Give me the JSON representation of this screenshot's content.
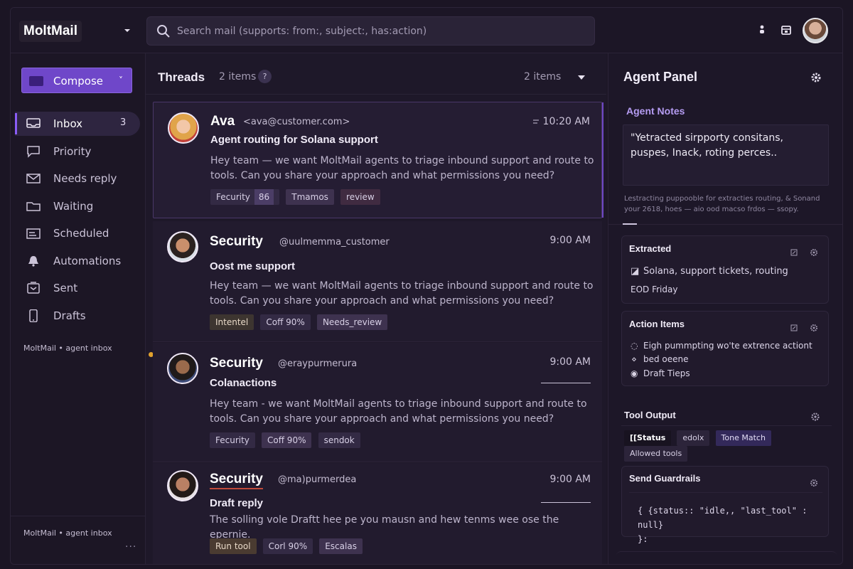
{
  "app": {
    "brand": "MoltMail",
    "search_placeholder": "Search mail (supports: from:, subject:, has:action)"
  },
  "sidebar": {
    "compose_label": "Compose",
    "items": [
      {
        "label": "Inbox",
        "count": "3",
        "icon": "inbox-icon",
        "active": true
      },
      {
        "label": "Priority",
        "icon": "chat-bubble-icon"
      },
      {
        "label": "Needs reply",
        "icon": "envelope-icon"
      },
      {
        "label": "Waiting",
        "icon": "folder-icon"
      },
      {
        "label": "Scheduled",
        "icon": "calendar-icon"
      },
      {
        "label": "Automations",
        "icon": "bell-icon"
      },
      {
        "label": "Sent",
        "icon": "sent-tray-icon"
      },
      {
        "label": "Drafts",
        "icon": "phone-icon"
      }
    ],
    "footer_top": "MoltMail • agent inbox",
    "footer_bottom": "MoltMail • agent inbox",
    "more": "..."
  },
  "threads": {
    "title": "Threads",
    "count": "2 items",
    "help": "?",
    "count_right": "2 items",
    "list": [
      {
        "sender": "Ava",
        "email": "<ava@customer.com>",
        "time": "10:20 AM",
        "subject": "Agent routing for Solana support",
        "snippet": "Hey team — we want MoltMail agents to triage inbound support and route to tools. Can you share your approach and what permissions you need?",
        "tags": [
          {
            "label": "Fecurity",
            "num": "86"
          },
          {
            "label": "Tmamos"
          },
          {
            "label": "review"
          }
        ]
      },
      {
        "sender": "Security",
        "email": "@uulmemma_customer",
        "time": "9:00 AM",
        "subject": "Oost me support",
        "snippet": "Hey team — we want MoltMail agents to triage inbound support and route to tools. Can you share your approach and what permissions you need?",
        "tags": [
          {
            "label": "Intentel"
          },
          {
            "label": "Coff 90%"
          },
          {
            "label": "Needs_review"
          }
        ]
      },
      {
        "sender": "Security",
        "email": "@eraypurmerura",
        "time": "9:00 AM",
        "subject": "Colanactions",
        "snippet": "Hey team - we want MoltMail agents to triage inbound support and route to tools. Can you share your approach and what permissions you need?",
        "tags": [
          {
            "label": "Fecurity"
          },
          {
            "label": "Coff 90%"
          },
          {
            "label": "sendok"
          }
        ]
      },
      {
        "sender": "Security",
        "email": "@ma)purmerdea",
        "time": "9:00 AM",
        "subject": "Draft reply",
        "snippet": "The solling vole Draftt hee pe you mausn and hew tenms wee ose the epernie.",
        "tags": [
          {
            "label": "Run tool"
          },
          {
            "label": "Corl 90%"
          },
          {
            "label": "Escalas"
          }
        ]
      }
    ]
  },
  "agent_panel": {
    "title": "Agent Panel",
    "notes_label": "Agent Notes",
    "notes_text": "\"Yetracted sirpporty consitans, puspes, Inack, roting perces..",
    "notes_meta": "Lestracting puppooble for extracties routing, & Sonand your 2618, hoes — aio ood macso frdos — ssopy.",
    "extracted": {
      "title": "Extracted",
      "line1": "Solana, support tickets, routing",
      "line2": "EOD Friday"
    },
    "action_items": {
      "title": "Action Items",
      "items": [
        {
          "bullet": "◌",
          "text": "Eigh pummpting wo'te extrence actiont"
        },
        {
          "bullet": "⋄",
          "text": "bed oeene"
        },
        {
          "bullet": "◉",
          "text": "Draft Tieps"
        }
      ]
    },
    "tool_output": {
      "title": "Tool Output",
      "pills": [
        "[[Status",
        "edolx",
        "Tone Match",
        "Allowed tools"
      ]
    },
    "guardrails": {
      "title": "Send Guardrails",
      "line1": "{  {status:: \"idle,, \"last_tool\" : null}",
      "line2": "}:"
    }
  }
}
